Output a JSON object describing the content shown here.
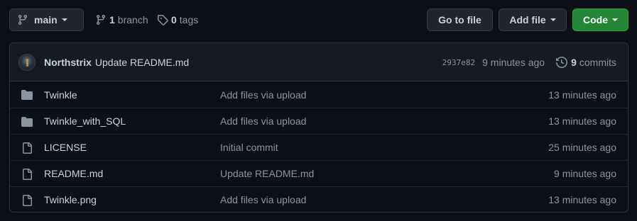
{
  "toolbar": {
    "branch_label": "main",
    "branch_count": "1",
    "branch_text": "branch",
    "tag_count": "0",
    "tag_text": "tags",
    "goto_label": "Go to file",
    "addfile_label": "Add file",
    "code_label": "Code"
  },
  "commit": {
    "author": "Northstrix",
    "message": "Update README.md",
    "sha": "2937e82",
    "ago": "9 minutes ago",
    "count": "9",
    "count_text": "commits"
  },
  "files": [
    {
      "name": "Twinkle",
      "type": "folder",
      "message": "Add files via upload",
      "age": "13 minutes ago"
    },
    {
      "name": "Twinkle_with_SQL",
      "type": "folder",
      "message": "Add files via upload",
      "age": "13 minutes ago"
    },
    {
      "name": "LICENSE",
      "type": "file",
      "message": "Initial commit",
      "age": "25 minutes ago"
    },
    {
      "name": "README.md",
      "type": "file",
      "message": "Update README.md",
      "age": "9 minutes ago"
    },
    {
      "name": "Twinkle.png",
      "type": "file",
      "message": "Add files via upload",
      "age": "13 minutes ago"
    }
  ],
  "colors": {
    "background": "#0d1117",
    "code_button": "#238636",
    "icon": "#8b949e"
  }
}
